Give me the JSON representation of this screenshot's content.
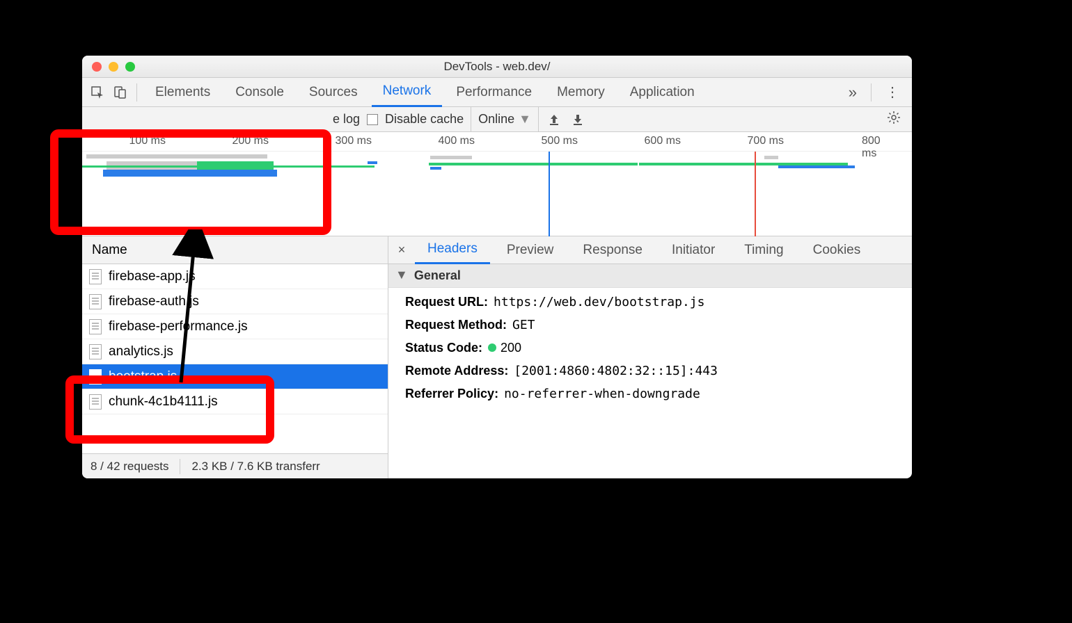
{
  "window": {
    "title": "DevTools - web.dev/"
  },
  "tabs": {
    "elements": "Elements",
    "console": "Console",
    "sources": "Sources",
    "network": "Network",
    "performance": "Performance",
    "memory": "Memory",
    "application": "Application"
  },
  "toolbar": {
    "preserve_log": "e log",
    "disable_cache": "Disable cache",
    "online": "Online"
  },
  "ruler": [
    "100 ms",
    "200 ms",
    "300 ms",
    "400 ms",
    "500 ms",
    "600 ms",
    "700 ms",
    "800 ms"
  ],
  "columns": {
    "name": "Name"
  },
  "requests": [
    {
      "name": "firebase-app.js",
      "selected": false
    },
    {
      "name": "firebase-auth.js",
      "selected": false
    },
    {
      "name": "firebase-performance.js",
      "selected": false
    },
    {
      "name": "analytics.js",
      "selected": false
    },
    {
      "name": "bootstrap.js",
      "selected": true
    },
    {
      "name": "chunk-4c1b4111.js",
      "selected": false
    }
  ],
  "status": {
    "requests": "8 / 42 requests",
    "transfer": "2.3 KB / 7.6 KB transferr"
  },
  "detail_tabs": {
    "headers": "Headers",
    "preview": "Preview",
    "response": "Response",
    "initiator": "Initiator",
    "timing": "Timing",
    "cookies": "Cookies"
  },
  "general": {
    "heading": "General",
    "request_url_k": "Request URL:",
    "request_url_v": "https://web.dev/bootstrap.js",
    "request_method_k": "Request Method:",
    "request_method_v": "GET",
    "status_code_k": "Status Code:",
    "status_code_v": "200",
    "remote_address_k": "Remote Address:",
    "remote_address_v": "[2001:4860:4802:32::15]:443",
    "referrer_policy_k": "Referrer Policy:",
    "referrer_policy_v": "no-referrer-when-downgrade"
  }
}
